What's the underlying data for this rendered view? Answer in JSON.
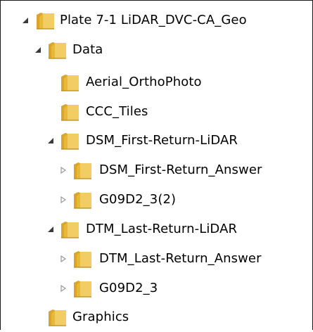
{
  "tree": {
    "nodes": [
      {
        "label": "Plate 7-1 LiDAR_DVC-CA_Geo",
        "expander": "expanded"
      },
      {
        "label": "Data",
        "expander": "expanded"
      },
      {
        "label": "Aerial_OrthoPhoto",
        "expander": "none"
      },
      {
        "label": "CCC_Tiles",
        "expander": "none"
      },
      {
        "label": "DSM_First-Return-LiDAR",
        "expander": "expanded"
      },
      {
        "label": "DSM_First-Return_Answer",
        "expander": "collapsed"
      },
      {
        "label": "G09D2_3(2)",
        "expander": "collapsed"
      },
      {
        "label": "DTM_Last-Return-LiDAR",
        "expander": "expanded"
      },
      {
        "label": "DTM_Last-Return_Answer",
        "expander": "collapsed"
      },
      {
        "label": "G09D2_3",
        "expander": "collapsed"
      },
      {
        "label": "Graphics",
        "expander": "none"
      }
    ]
  },
  "icons": {
    "folder": "folder-icon",
    "expanded": "expanded-triangle-icon",
    "collapsed": "collapsed-triangle-icon"
  },
  "colors": {
    "folder_body": "#e8b83a",
    "folder_light": "#f7dc7a",
    "expanded_arrow": "#3a3a3a",
    "collapsed_arrow": "#9a9a9a"
  }
}
